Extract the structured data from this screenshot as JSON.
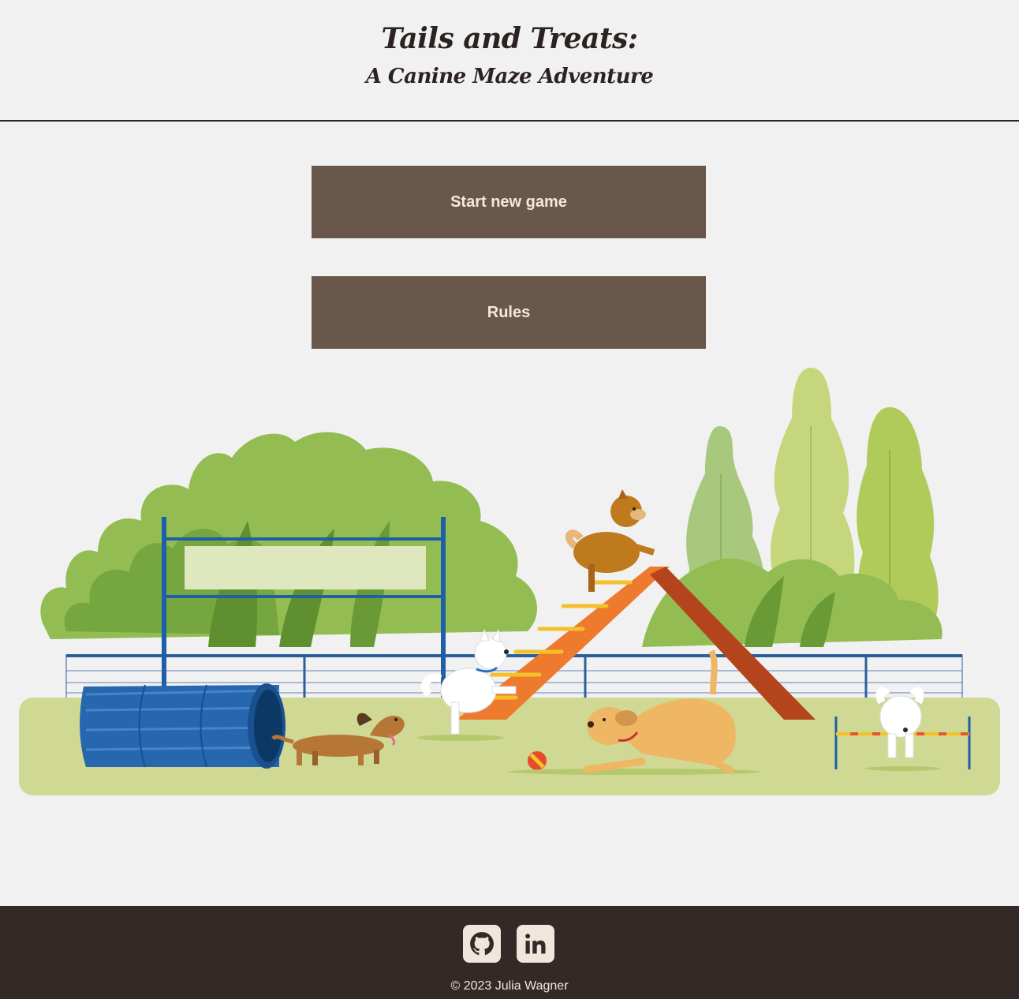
{
  "header": {
    "title": "Tails and Treats:",
    "subtitle": "A Canine Maze Adventure"
  },
  "menu": {
    "start_label": "Start new game",
    "rules_label": "Rules"
  },
  "illustration": {
    "subject": "dog-agility-park-illustration"
  },
  "footer": {
    "social": [
      {
        "icon": "github-icon"
      },
      {
        "icon": "linkedin-icon"
      }
    ],
    "copyright": "© 2023 Julia Wagner"
  },
  "colors": {
    "background": "#f1f1f1",
    "text_dark": "#2b2321",
    "button_bg": "#6a574b",
    "button_text": "#f2e9dc",
    "footer_bg": "#342927",
    "footer_text": "#efe7dc",
    "grass": "#cfd993"
  }
}
